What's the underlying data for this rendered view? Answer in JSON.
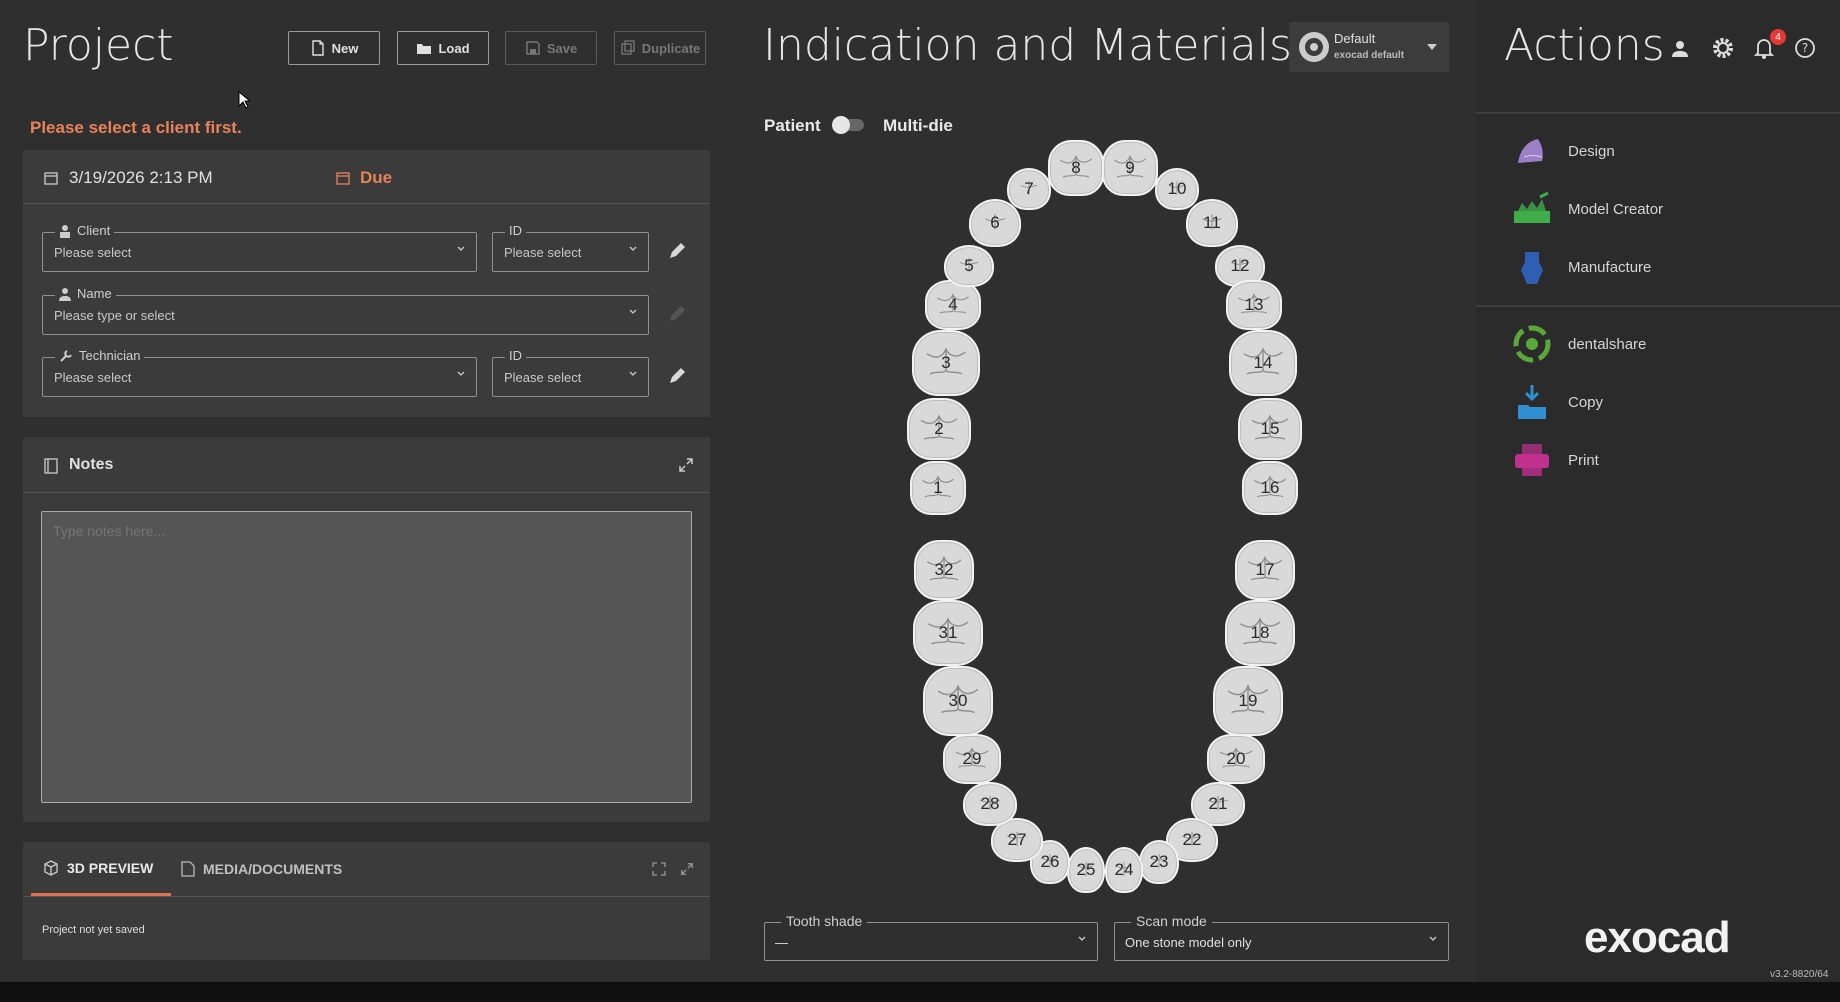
{
  "project": {
    "title": "Project",
    "buttons": {
      "new": "New",
      "load": "Load",
      "save": "Save",
      "duplicate": "Duplicate"
    },
    "warning": "Please select a client first.",
    "date": "3/19/2026 2:13 PM",
    "due": "Due",
    "client_label": "Client",
    "client_placeholder": "Please select",
    "client_id_label": "ID",
    "client_id_placeholder": "Please select",
    "name_label": "Name",
    "name_placeholder": "Please type or select",
    "technician_label": "Technician",
    "technician_placeholder": "Please select",
    "technician_id_label": "ID",
    "technician_id_placeholder": "Please select",
    "notes_title": "Notes",
    "notes_placeholder": "Type notes here...",
    "tab_preview": "3D PREVIEW",
    "tab_media": "MEDIA/DOCUMENTS",
    "preview_status": "Project not yet saved"
  },
  "indication": {
    "title": "Indication and Materials",
    "profile_name": "Default",
    "profile_sub": "exocad default",
    "toggle_left": "Patient",
    "toggle_right": "Multi-die",
    "teeth": [
      "1",
      "2",
      "3",
      "4",
      "5",
      "6",
      "7",
      "8",
      "9",
      "10",
      "11",
      "12",
      "13",
      "14",
      "15",
      "16",
      "17",
      "18",
      "19",
      "20",
      "21",
      "22",
      "23",
      "24",
      "25",
      "26",
      "27",
      "28",
      "29",
      "30",
      "31",
      "32"
    ],
    "tooth_shade_label": "Tooth shade",
    "tooth_shade_value": "—",
    "scan_mode_label": "Scan mode",
    "scan_mode_value": "One stone model only"
  },
  "actions": {
    "title": "Actions",
    "notification_count": "4",
    "items": [
      {
        "label": "Design",
        "icon": "design-icon",
        "color": "#9b7fc7"
      },
      {
        "label": "Model Creator",
        "icon": "model-creator-icon",
        "color": "#3fae49"
      },
      {
        "label": "Manufacture",
        "icon": "manufacture-icon",
        "color": "#2f5fb3"
      },
      {
        "label": "dentalshare",
        "icon": "dentalshare-icon",
        "color": "#5aa83a"
      },
      {
        "label": "Copy",
        "icon": "copy-icon",
        "color": "#2f8fd1"
      },
      {
        "label": "Print",
        "icon": "print-icon",
        "color": "#c0308f"
      }
    ],
    "brand": "exocad",
    "version": "v3.2-8820/64"
  },
  "colors": {
    "accent_orange": "#e8825a",
    "tab_underline": "#e07050",
    "badge": "#e53935"
  }
}
